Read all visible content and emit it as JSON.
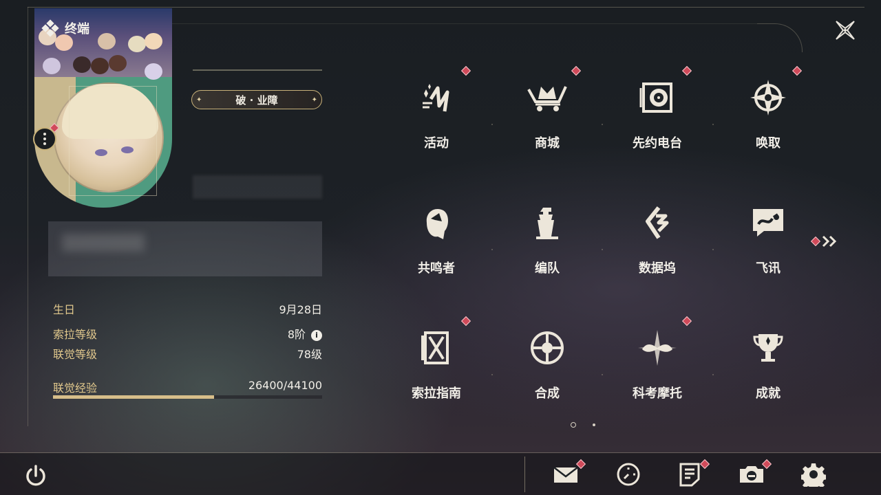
{
  "header": {
    "title": "终端",
    "title_icon": "terminal-diamond-icon",
    "close_icon": "close-icon"
  },
  "profile": {
    "title_badge": "破 · 业障",
    "stats": [
      {
        "label": "生日",
        "value": "9月28日"
      },
      {
        "label": "索拉等级",
        "value": "8阶"
      },
      {
        "label": "联觉等级",
        "value": "78级"
      },
      {
        "label": "联觉经验",
        "value": "26400/44100"
      }
    ],
    "exp_progress": 0.599,
    "info_icon": "i"
  },
  "grid": {
    "items": [
      {
        "label": "活动",
        "icon": "events-icon",
        "badge": true
      },
      {
        "label": "商城",
        "icon": "shop-crown-cart-icon",
        "badge": true
      },
      {
        "label": "先约电台",
        "icon": "radio-disc-icon",
        "badge": true
      },
      {
        "label": "唤取",
        "icon": "convene-compass-icon",
        "badge": true
      },
      {
        "label": "共鸣者",
        "icon": "resonator-head-icon",
        "badge": false
      },
      {
        "label": "编队",
        "icon": "team-chess-icon",
        "badge": false
      },
      {
        "label": "数据坞",
        "icon": "data-bank-icon",
        "badge": false
      },
      {
        "label": "飞讯",
        "icon": "message-bubble-icon",
        "badge": false
      },
      {
        "label": "索拉指南",
        "icon": "guidebook-icon",
        "badge": true
      },
      {
        "label": "合成",
        "icon": "synthesis-ring-icon",
        "badge": false
      },
      {
        "label": "科考摩托",
        "icon": "motorcycle-icon",
        "badge": true
      },
      {
        "label": "成就",
        "icon": "trophy-icon",
        "badge": false
      }
    ],
    "next_page_icon": "double-chevron-right-icon",
    "current_page": 1,
    "page_count": 2
  },
  "bottom_bar": {
    "power_icon": "power-icon",
    "icons": [
      "mail-icon",
      "clock-icon",
      "notes-icon",
      "camera-icon",
      "settings-gear-icon"
    ]
  },
  "colors": {
    "accent_gold": "#c9b27a",
    "badge_red": "#d04a5a",
    "label_gold": "#e0c78c"
  }
}
